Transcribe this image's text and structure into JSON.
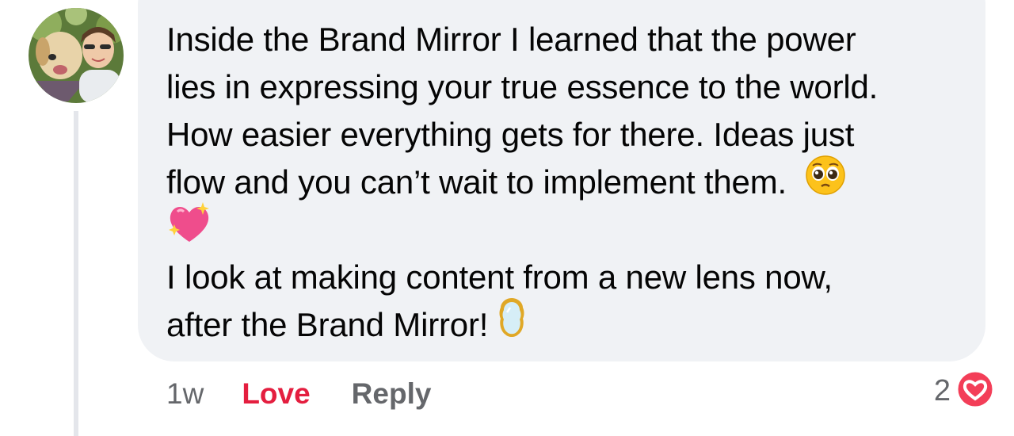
{
  "comment": {
    "lines": [
      "Inside the Brand Mirror I learned that the power",
      "lies in expressing your true essence to the world.",
      "How easier everything gets for there. Ideas just",
      "flow and you can’t wait to implement them.",
      "I look at making content from a new lens now,",
      "after the Brand Mirror!"
    ],
    "emoji_1": "pleading-face",
    "emoji_2": "sparkling-heart",
    "emoji_3": "mirror"
  },
  "actions": {
    "time": "1w",
    "love_label": "Love",
    "reply_label": "Reply"
  },
  "reactions": {
    "count": "2",
    "type": "love"
  },
  "colors": {
    "bubble": "#f0f2f5",
    "love": "#e41e3f",
    "meta": "#65676b",
    "text": "#050505"
  }
}
